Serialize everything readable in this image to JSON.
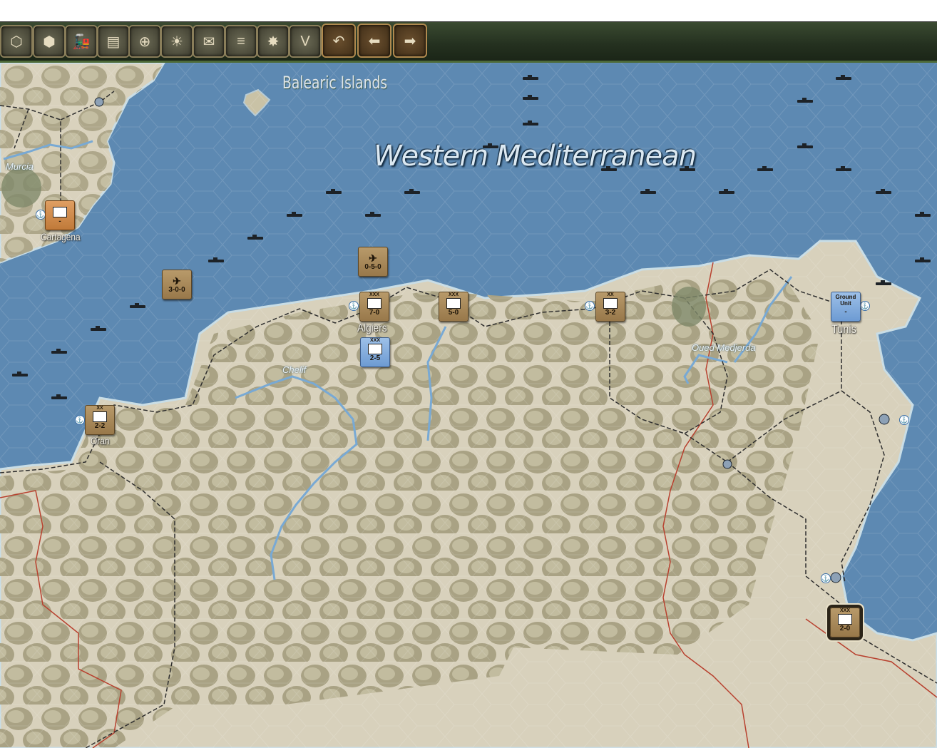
{
  "toolbar": {
    "buttons": [
      {
        "name": "terrain-toggle-button",
        "glyph": "⬡"
      },
      {
        "name": "hex-grid-button",
        "glyph": "⬢"
      },
      {
        "name": "railroad-button",
        "glyph": "🚂"
      },
      {
        "name": "supply-button",
        "glyph": "▤"
      },
      {
        "name": "target-button",
        "glyph": "⊕"
      },
      {
        "name": "weather-button",
        "glyph": "☀"
      },
      {
        "name": "unit-display-button",
        "glyph": "✉"
      },
      {
        "name": "stack-button",
        "glyph": "≡"
      },
      {
        "name": "combat-button",
        "glyph": "✸"
      },
      {
        "name": "victory-button",
        "glyph": "V"
      }
    ],
    "undo": "↶",
    "back": "⬅",
    "forward": "➡"
  },
  "map": {
    "sea_name": "Western Mediterranean",
    "islands_name": "Balearic Islands",
    "cities": [
      {
        "name": "Cartagena"
      },
      {
        "name": "Algiers"
      },
      {
        "name": "Oran"
      },
      {
        "name": "Tunis"
      }
    ],
    "rivers": [
      {
        "name": "Murcia"
      },
      {
        "name": "Chelif"
      },
      {
        "name": "Oued Medjerda"
      }
    ]
  },
  "units": [
    {
      "id": "cartagena",
      "size": "",
      "strength": "-",
      "style": "orange"
    },
    {
      "id": "air-1",
      "size": "",
      "strength": "3-0-0",
      "style": "tan",
      "kind": "air"
    },
    {
      "id": "air-2",
      "size": "",
      "strength": "0-5-0",
      "style": "tan",
      "kind": "air"
    },
    {
      "id": "algiers-1",
      "size": "XXX",
      "strength": "7-0",
      "style": "tan"
    },
    {
      "id": "algiers-2",
      "size": "XXX",
      "strength": "2-5",
      "style": "blue"
    },
    {
      "id": "east-algiers",
      "size": "XXX",
      "strength": "5-0",
      "style": "tan"
    },
    {
      "id": "bougie",
      "size": "XX",
      "strength": "3-2",
      "style": "tan"
    },
    {
      "id": "oran",
      "size": "XX",
      "strength": "2-2",
      "style": "tan"
    },
    {
      "id": "tunis",
      "size": "Ground Unit",
      "strength": "-",
      "style": "blue"
    },
    {
      "id": "south-tunisia",
      "size": "XXX",
      "strength": "2-0",
      "style": "tan"
    }
  ],
  "colors": {
    "sea": "#5b88b3",
    "land": "#d8d2bf",
    "mountain": "#aaa48a",
    "border": "#b23a2c",
    "rail": "#2a2a2a",
    "river": "#6aa1d1"
  }
}
